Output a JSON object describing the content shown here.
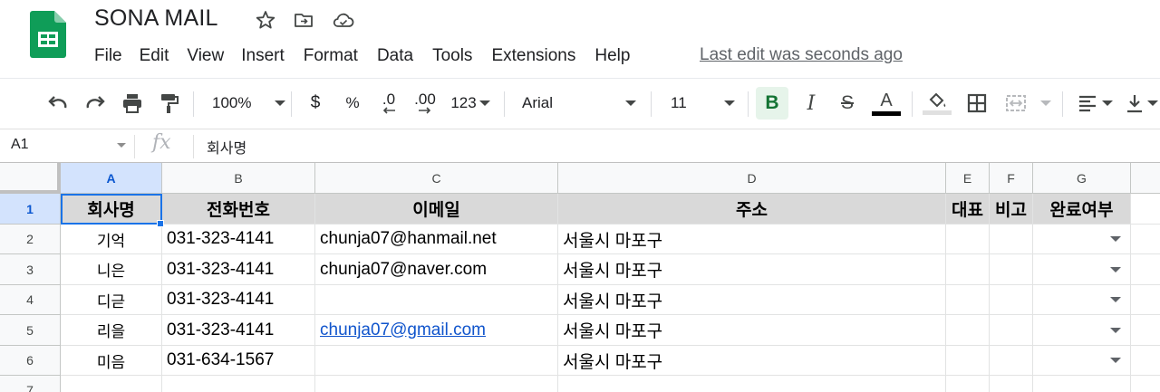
{
  "app": {
    "doc_title": "SONA MAIL",
    "last_edit": "Last edit was seconds ago",
    "menu": [
      "File",
      "Edit",
      "View",
      "Insert",
      "Format",
      "Data",
      "Tools",
      "Extensions",
      "Help"
    ]
  },
  "toolbar": {
    "zoom": "100%",
    "currency": "$",
    "percent": "%",
    "decrease_decimals": ".0",
    "increase_decimals": ".00",
    "more_formats": "123",
    "font": "Arial",
    "font_size": "11",
    "bold": "B",
    "italic": "I",
    "strikethrough": "S",
    "text_color": "A",
    "text_color_value": "#000000",
    "bold_active": true
  },
  "formula_bar": {
    "cell_ref": "A1",
    "fx": "fx",
    "value": "회사명"
  },
  "sheet": {
    "selected_cell": "A1",
    "columns": [
      "A",
      "B",
      "C",
      "D",
      "E",
      "F",
      "G"
    ],
    "row_numbers": [
      "1",
      "2",
      "3",
      "4",
      "5",
      "6",
      "7"
    ],
    "header_row": [
      "회사명",
      "전화번호",
      "이메일",
      "주소",
      "대표",
      "비고",
      "완료여부"
    ],
    "rows": [
      {
        "company": "기억",
        "phone": "031-323-4141",
        "email": "chunja07@hanmail.net",
        "address": "서울시 마포구",
        "rep": "",
        "note": "",
        "done": ""
      },
      {
        "company": "니은",
        "phone": "031-323-4141",
        "email": "chunja07@naver.com",
        "address": "서울시 마포구",
        "rep": "",
        "note": "",
        "done": ""
      },
      {
        "company": "디귿",
        "phone": "031-323-4141",
        "email": "",
        "address": "서울시 마포구",
        "rep": "",
        "note": "",
        "done": ""
      },
      {
        "company": "리을",
        "phone": "031-323-4141",
        "email": "chunja07@gmail.com",
        "address": "서울시 마포구",
        "rep": "",
        "note": "",
        "done": ""
      },
      {
        "company": "미음",
        "phone": "031-634-1567",
        "email": "",
        "address": "서울시 마포구",
        "rep": "",
        "note": "",
        "done": ""
      }
    ],
    "link_email": "chunja07@gmail.com"
  },
  "colors": {
    "header_fill": "#d9d9d9",
    "selection": "#1a73e8",
    "link": "#1155cc",
    "sheets_green": "#0f9d58"
  }
}
